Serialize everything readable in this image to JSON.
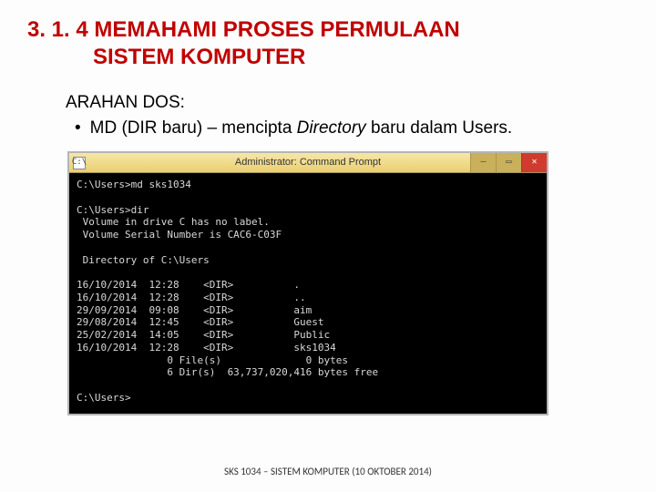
{
  "heading": {
    "line1": "3. 1. 4 MEMAHAMI PROSES PERMULAAN",
    "line2": "SISTEM KOMPUTER"
  },
  "subtitle": "ARAHAN DOS:",
  "bullet": {
    "dot": "•",
    "prefix": "MD (DIR baru) – mencipta ",
    "italic": "Directory",
    "suffix": " baru dalam Users."
  },
  "cmd": {
    "icon_glyph": "C:\\",
    "title": "Administrator: Command Prompt",
    "btn_min": "–",
    "btn_max": "▭",
    "btn_close": "✕",
    "lines": "C:\\Users>md sks1034\n\nC:\\Users>dir\n Volume in drive C has no label.\n Volume Serial Number is CAC6-C03F\n\n Directory of C:\\Users\n\n16/10/2014  12:28    <DIR>          .\n16/10/2014  12:28    <DIR>          ..\n29/09/2014  09:08    <DIR>          aim\n29/08/2014  12:45    <DIR>          Guest\n25/02/2014  14:05    <DIR>          Public\n16/10/2014  12:28    <DIR>          sks1034\n               0 File(s)              0 bytes\n               6 Dir(s)  63,737,020,416 bytes free\n\nC:\\Users>"
  },
  "footer": "SKS 1034 – SISTEM KOMPUTER (10 OKTOBER 2014)"
}
